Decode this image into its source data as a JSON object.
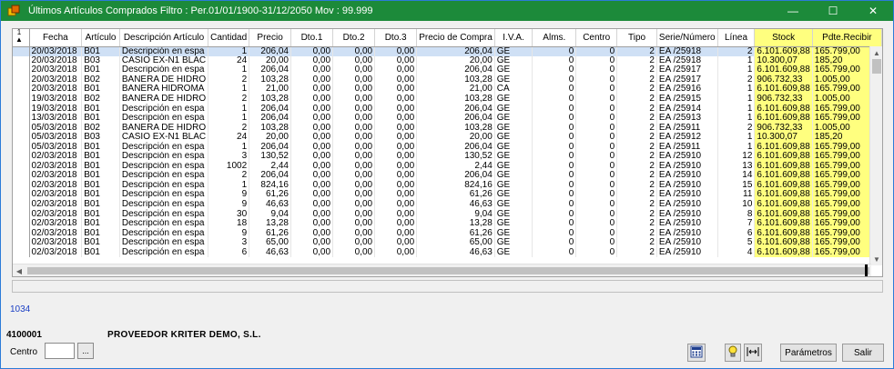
{
  "window": {
    "title": "Últimos Artículos Comprados Filtro : Per.01/01/1900-31/12/2050 Mov : 99.999",
    "controls": {
      "minimize": "—",
      "maximize": "☐",
      "close": "✕"
    }
  },
  "grid": {
    "sort_marker": "1\n▲",
    "columns": [
      "Fecha",
      "Artículo",
      "Descripción Artículo",
      "Cantidad",
      "Precio",
      "Dto.1",
      "Dto.2",
      "Dto.3",
      "Precio de Compra",
      "I.V.A.",
      "Alms.",
      "Centro",
      "Tipo",
      "Serie/Número",
      "Línea",
      "Stock",
      "Pdte.Recibir"
    ],
    "rows": [
      [
        "20/03/2018",
        "B01",
        "Descripción en espa",
        "1",
        "206,04",
        "0,00",
        "0,00",
        "0,00",
        "206,04",
        "GE",
        "0",
        "0",
        "2",
        "EA /25918",
        "2",
        "6.101.609,88",
        "165.799,00"
      ],
      [
        "20/03/2018",
        "B03",
        "CASIO EX-N1 BLAC",
        "24",
        "20,00",
        "0,00",
        "0,00",
        "0,00",
        "20,00",
        "GE",
        "0",
        "0",
        "2",
        "EA /25918",
        "1",
        "10.300,07",
        "185,20"
      ],
      [
        "20/03/2018",
        "B01",
        "Descripción en espa",
        "1",
        "206,04",
        "0,00",
        "0,00",
        "0,00",
        "206,04",
        "GE",
        "0",
        "0",
        "2",
        "EA /25917",
        "1",
        "6.101.609,88",
        "165.799,00"
      ],
      [
        "20/03/2018",
        "B02",
        "BAÑERA DE HIDRO",
        "2",
        "103,28",
        "0,00",
        "0,00",
        "0,00",
        "103,28",
        "GE",
        "0",
        "0",
        "2",
        "EA /25917",
        "2",
        "906.732,33",
        "1.005,00"
      ],
      [
        "20/03/2018",
        "B01",
        "BAÑERA HIDROMA",
        "1",
        "21,00",
        "0,00",
        "0,00",
        "0,00",
        "21,00",
        "CA",
        "0",
        "0",
        "2",
        "EA /25916",
        "1",
        "6.101.609,88",
        "165.799,00"
      ],
      [
        "19/03/2018",
        "B02",
        "BAÑERA DE HIDRO",
        "2",
        "103,28",
        "0,00",
        "0,00",
        "0,00",
        "103,28",
        "GE",
        "0",
        "0",
        "2",
        "EA /25915",
        "1",
        "906.732,33",
        "1.005,00"
      ],
      [
        "19/03/2018",
        "B01",
        "Descripción en espa",
        "1",
        "206,04",
        "0,00",
        "0,00",
        "0,00",
        "206,04",
        "GE",
        "0",
        "0",
        "2",
        "EA /25914",
        "1",
        "6.101.609,88",
        "165.799,00"
      ],
      [
        "13/03/2018",
        "B01",
        "Descripción en espa",
        "1",
        "206,04",
        "0,00",
        "0,00",
        "0,00",
        "206,04",
        "GE",
        "0",
        "0",
        "2",
        "EA /25913",
        "1",
        "6.101.609,88",
        "165.799,00"
      ],
      [
        "05/03/2018",
        "B02",
        "BAÑERA DE HIDRO",
        "2",
        "103,28",
        "0,00",
        "0,00",
        "0,00",
        "103,28",
        "GE",
        "0",
        "0",
        "2",
        "EA /25911",
        "2",
        "906.732,33",
        "1.005,00"
      ],
      [
        "05/03/2018",
        "B03",
        "CASIO EX-N1 BLAC",
        "24",
        "20,00",
        "0,00",
        "0,00",
        "0,00",
        "20,00",
        "GE",
        "0",
        "0",
        "2",
        "EA /25912",
        "1",
        "10.300,07",
        "185,20"
      ],
      [
        "05/03/2018",
        "B01",
        "Descripción en espa",
        "1",
        "206,04",
        "0,00",
        "0,00",
        "0,00",
        "206,04",
        "GE",
        "0",
        "0",
        "2",
        "EA /25911",
        "1",
        "6.101.609,88",
        "165.799,00"
      ],
      [
        "02/03/2018",
        "B01",
        "Descripción en espa",
        "3",
        "130,52",
        "0,00",
        "0,00",
        "0,00",
        "130,52",
        "GE",
        "0",
        "0",
        "2",
        "EA /25910",
        "12",
        "6.101.609,88",
        "165.799,00"
      ],
      [
        "02/03/2018",
        "B01",
        "Descripción en espa",
        "1002",
        "2,44",
        "0,00",
        "0,00",
        "0,00",
        "2,44",
        "GE",
        "0",
        "0",
        "2",
        "EA /25910",
        "13",
        "6.101.609,88",
        "165.799,00"
      ],
      [
        "02/03/2018",
        "B01",
        "Descripción en espa",
        "2",
        "206,04",
        "0,00",
        "0,00",
        "0,00",
        "206,04",
        "GE",
        "0",
        "0",
        "2",
        "EA /25910",
        "14",
        "6.101.609,88",
        "165.799,00"
      ],
      [
        "02/03/2018",
        "B01",
        "Descripción en espa",
        "1",
        "824,16",
        "0,00",
        "0,00",
        "0,00",
        "824,16",
        "GE",
        "0",
        "0",
        "2",
        "EA /25910",
        "15",
        "6.101.609,88",
        "165.799,00"
      ],
      [
        "02/03/2018",
        "B01",
        "Descripción en espa",
        "9",
        "61,26",
        "0,00",
        "0,00",
        "0,00",
        "61,26",
        "GE",
        "0",
        "0",
        "2",
        "EA /25910",
        "11",
        "6.101.609,88",
        "165.799,00"
      ],
      [
        "02/03/2018",
        "B01",
        "Descripción en espa",
        "9",
        "46,63",
        "0,00",
        "0,00",
        "0,00",
        "46,63",
        "GE",
        "0",
        "0",
        "2",
        "EA /25910",
        "10",
        "6.101.609,88",
        "165.799,00"
      ],
      [
        "02/03/2018",
        "B01",
        "Descripción en espa",
        "30",
        "9,04",
        "0,00",
        "0,00",
        "0,00",
        "9,04",
        "GE",
        "0",
        "0",
        "2",
        "EA /25910",
        "8",
        "6.101.609,88",
        "165.799,00"
      ],
      [
        "02/03/2018",
        "B01",
        "Descripción en espa",
        "18",
        "13,28",
        "0,00",
        "0,00",
        "0,00",
        "13,28",
        "GE",
        "0",
        "0",
        "2",
        "EA /25910",
        "7",
        "6.101.609,88",
        "165.799,00"
      ],
      [
        "02/03/2018",
        "B01",
        "Descripción en espa",
        "9",
        "61,26",
        "0,00",
        "0,00",
        "0,00",
        "61,26",
        "GE",
        "0",
        "0",
        "2",
        "EA /25910",
        "6",
        "6.101.609,88",
        "165.799,00"
      ],
      [
        "02/03/2018",
        "B01",
        "Descripción en espa",
        "3",
        "65,00",
        "0,00",
        "0,00",
        "0,00",
        "65,00",
        "GE",
        "0",
        "0",
        "2",
        "EA /25910",
        "5",
        "6.101.609,88",
        "165.799,00"
      ],
      [
        "02/03/2018",
        "B01",
        "Descripción en espa",
        "6",
        "46,63",
        "0,00",
        "0,00",
        "0,00",
        "46,63",
        "GE",
        "0",
        "0",
        "2",
        "EA /25910",
        "4",
        "6.101.609,88",
        "165.799,00"
      ]
    ]
  },
  "footer": {
    "record_count": "1034",
    "provider_code": "4100001",
    "provider_name": "PROVEEDOR KRITER DEMO, S.L.",
    "centro_label": "Centro",
    "centro_value": "",
    "browse_button": "...",
    "params_button": "Parámetros",
    "exit_button": "Salir"
  },
  "colors": {
    "titlebar": "#1c8a3a",
    "highlight_columns": "#ffff7f",
    "selected_row": "#cfe0f5",
    "count_text": "#1b3fc4"
  },
  "icons": [
    "app-icon",
    "minimize-icon",
    "maximize-icon",
    "close-icon",
    "calculator-icon",
    "lightbulb-icon",
    "column-width-icon"
  ]
}
